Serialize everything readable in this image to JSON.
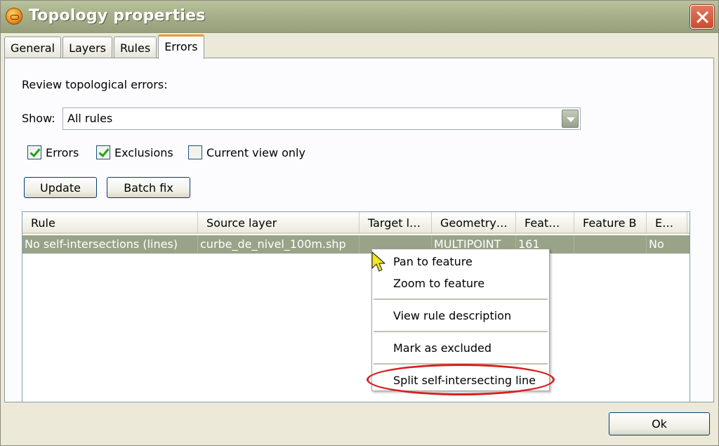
{
  "window": {
    "title": "Topology properties"
  },
  "tabs": [
    {
      "label": "General"
    },
    {
      "label": "Layers"
    },
    {
      "label": "Rules"
    },
    {
      "label": "Errors",
      "active": true
    }
  ],
  "errors_panel": {
    "review_label": "Review topological errors:",
    "show_label": "Show:",
    "show_value": "All rules",
    "checkboxes": [
      {
        "label": "Errors",
        "checked": true
      },
      {
        "label": "Exclusions",
        "checked": true
      },
      {
        "label": "Current view only",
        "checked": false
      }
    ],
    "update_button": "Update",
    "batch_fix_button": "Batch fix"
  },
  "table": {
    "columns": [
      "Rule",
      "Source layer",
      "Target l…",
      "Geometry…",
      "Feat…",
      "Feature B",
      "E…"
    ],
    "rows": [
      {
        "rule": "No self-intersections (lines)",
        "source_layer": "curbe_de_nivel_100m.shp",
        "target_layer": "",
        "geometry": "MULTIPOINT",
        "feature_a": "161",
        "feature_b": "",
        "excluded": "No"
      }
    ]
  },
  "context_menu": {
    "items": [
      {
        "label": "Pan to feature"
      },
      {
        "label": "Zoom to feature"
      },
      {
        "label": "View rule description"
      },
      {
        "label": "Mark as excluded"
      },
      {
        "label": "Split self-intersecting line",
        "highlighted": true
      }
    ]
  },
  "footer": {
    "ok_button": "Ok"
  },
  "icons": {
    "app": "app-logo-icon",
    "close": "close-icon",
    "dropdown": "chevron-down-icon",
    "checkbox": "checkmark-icon",
    "cursor": "mouse-pointer-icon"
  },
  "colors": {
    "titlebar": "#a3ad86",
    "selected_row": "#98a387",
    "close_button": "#cc4a2e",
    "highlight_ellipse": "#d82020",
    "active_tab_accent": "#e69a32"
  }
}
